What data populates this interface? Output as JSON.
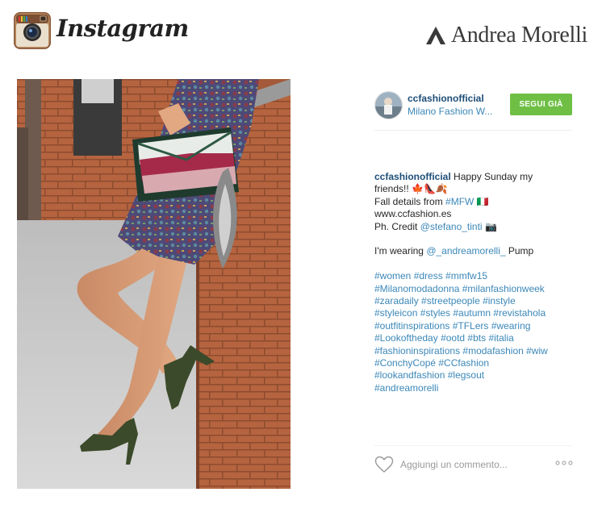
{
  "header": {
    "instagram_wordmark": "Instagram",
    "brand_name": "Andrea Morelli"
  },
  "post": {
    "username": "ccfashionofficial",
    "location": "Milano Fashion W...",
    "follow_label": "SEGUI GIÀ",
    "caption": {
      "username": "ccfashionofficial",
      "lines": [
        "Happy Sunday my",
        "friends!! 🍁👠🍂",
        "Fall details from ",
        "#MFW",
        " 🇮🇹",
        "www.ccfashion.es",
        "Ph. Credit ",
        "@stefano_tinti",
        " 📷"
      ],
      "wearing_text": "I'm wearing ",
      "wearing_mention": "@_andreamorelli_",
      "wearing_suffix": " Pump",
      "hashtags": [
        "#women #dress #mmfw15",
        "#Milanomodadonna #milanfashionweek",
        "#zaradaily #streetpeople #instyle",
        "#styleicon #styles #autumn #revistahola",
        "#outfitinspirations #TFLers #wearing",
        "#Lookoftheday #ootd #bts #italia",
        "#fashioninspirations #modafashion #wiw",
        "#ConchyCopé #CCfashion",
        "#lookandfashion #legsout",
        "#andreamorelli"
      ]
    },
    "comment_placeholder": "Aggiungi un commento...",
    "icons": {
      "like": "heart-icon",
      "more": "more-options-icon",
      "logo": "instagram-camera-icon"
    }
  },
  "colors": {
    "follow_green": "#6fbf45",
    "link_blue": "#3b87b8",
    "username_blue": "#1e4e78"
  }
}
